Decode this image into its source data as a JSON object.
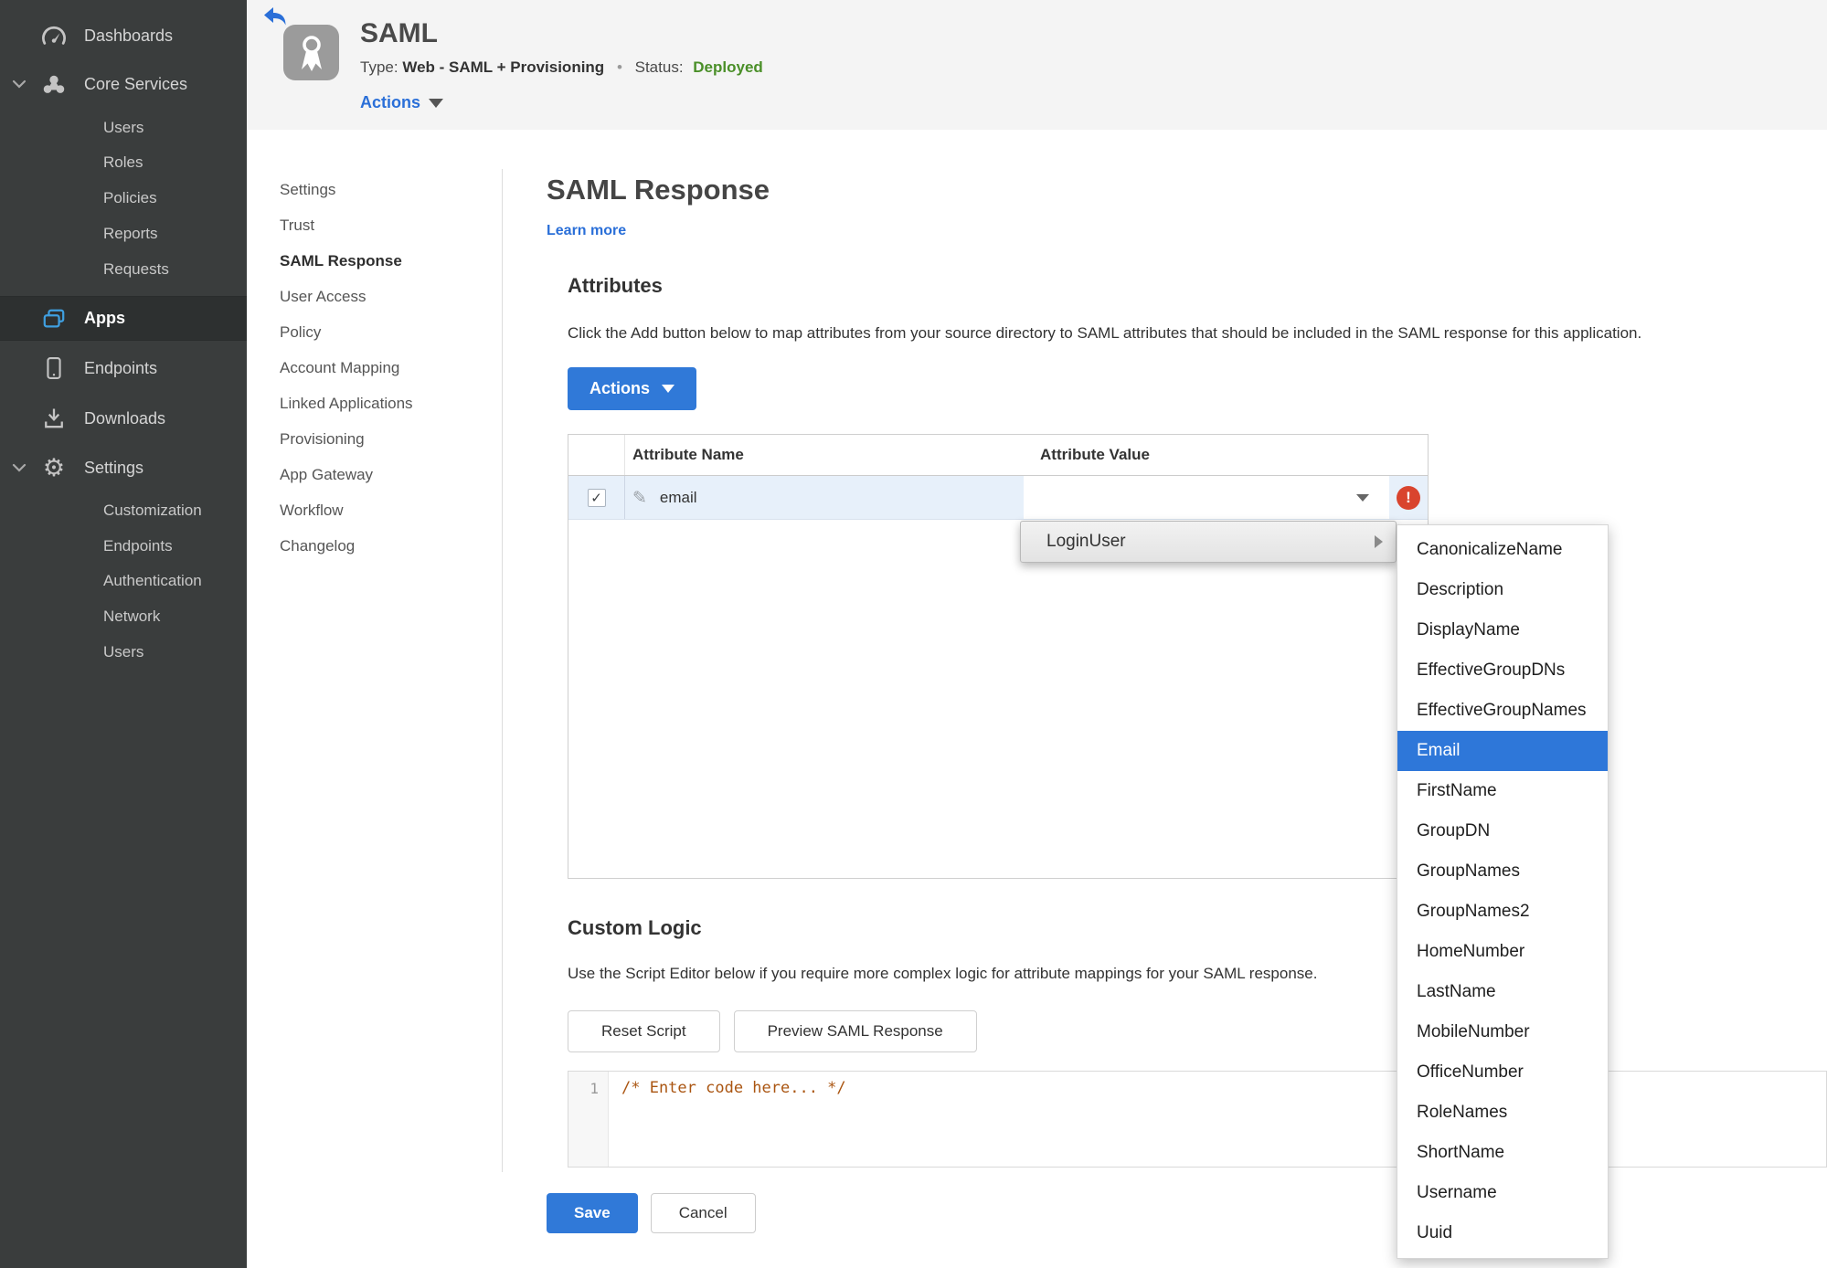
{
  "colors": {
    "accent_blue": "#3079d8",
    "link_blue": "#2a6fd8",
    "status_green": "#4a8f28",
    "error_red": "#d9442e",
    "sidebar_bg": "#3a3d3d",
    "row_highlight": "#e7f0fa",
    "selected_option_bg": "#2e77d9"
  },
  "sidebar": {
    "items": [
      {
        "label": "Dashboards",
        "icon": "gauge-icon"
      },
      {
        "label": "Core Services",
        "icon": "cluster-icon",
        "expanded": true
      },
      {
        "label": "Users",
        "indent": true
      },
      {
        "label": "Roles",
        "indent": true
      },
      {
        "label": "Policies",
        "indent": true
      },
      {
        "label": "Reports",
        "indent": true
      },
      {
        "label": "Requests",
        "indent": true
      },
      {
        "label": "Apps",
        "icon": "apps-icon",
        "active": true
      },
      {
        "label": "Endpoints",
        "icon": "tablet-icon"
      },
      {
        "label": "Downloads",
        "icon": "download-icon"
      },
      {
        "label": "Settings",
        "icon": "gear-icon",
        "expanded": true
      },
      {
        "label": "Customization",
        "indent": true
      },
      {
        "label": "Endpoints",
        "indent": true
      },
      {
        "label": "Authentication",
        "indent": true
      },
      {
        "label": "Network",
        "indent": true
      },
      {
        "label": "Users",
        "indent": true
      }
    ]
  },
  "header": {
    "title": "SAML",
    "type_label": "Type:",
    "type_value": "Web - SAML + Provisioning",
    "separator": "•",
    "status_label": "Status:",
    "status_value": "Deployed",
    "actions_label": "Actions"
  },
  "subnav": {
    "items": [
      {
        "label": "Settings"
      },
      {
        "label": "Trust"
      },
      {
        "label": "SAML Response",
        "active": true
      },
      {
        "label": "User Access"
      },
      {
        "label": "Policy"
      },
      {
        "label": "Account Mapping"
      },
      {
        "label": "Linked Applications"
      },
      {
        "label": "Provisioning"
      },
      {
        "label": "App Gateway"
      },
      {
        "label": "Workflow"
      },
      {
        "label": "Changelog"
      }
    ]
  },
  "main": {
    "title": "SAML Response",
    "learn_more": "Learn more",
    "attributes": {
      "heading": "Attributes",
      "description": "Click the Add button below to map attributes from your source directory to SAML attributes that should be included in the SAML response for this application.",
      "actions_button": "Actions",
      "table": {
        "columns": [
          "Attribute Name",
          "Attribute Value"
        ],
        "rows": [
          {
            "name": "email",
            "value": "",
            "checked": true,
            "error": true
          }
        ]
      }
    },
    "custom_logic": {
      "heading": "Custom Logic",
      "description": "Use the Script Editor below if you require more complex logic for attribute mappings for your SAML response.",
      "reset_button": "Reset Script",
      "preview_button": "Preview SAML Response",
      "editor": {
        "line_number": "1",
        "code": "/* Enter code here... */"
      }
    },
    "save_label": "Save",
    "cancel_label": "Cancel"
  },
  "menu": {
    "parent_item": "LoginUser",
    "options": [
      {
        "label": "CanonicalizeName"
      },
      {
        "label": "Description"
      },
      {
        "label": "DisplayName"
      },
      {
        "label": "EffectiveGroupDNs"
      },
      {
        "label": "EffectiveGroupNames"
      },
      {
        "label": "Email",
        "selected": true
      },
      {
        "label": "FirstName"
      },
      {
        "label": "GroupDN"
      },
      {
        "label": "GroupNames"
      },
      {
        "label": "GroupNames2"
      },
      {
        "label": "HomeNumber"
      },
      {
        "label": "LastName"
      },
      {
        "label": "MobileNumber"
      },
      {
        "label": "OfficeNumber"
      },
      {
        "label": "RoleNames"
      },
      {
        "label": "ShortName"
      },
      {
        "label": "Username"
      },
      {
        "label": "Uuid"
      }
    ]
  }
}
